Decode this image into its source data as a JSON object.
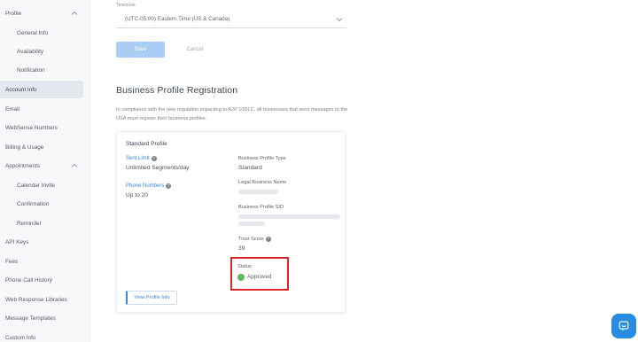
{
  "sidebar": {
    "items": [
      {
        "label": "Profile",
        "expanded": true
      },
      {
        "label": "General Info"
      },
      {
        "label": "Availability"
      },
      {
        "label": "Notification"
      },
      {
        "label": "Account Info",
        "active": true
      },
      {
        "label": "Email"
      },
      {
        "label": "WebSense Numbers"
      },
      {
        "label": "Billing & Usage"
      },
      {
        "label": "Appointments",
        "expanded": true
      },
      {
        "label": "Calendar Invite"
      },
      {
        "label": "Confirmation"
      },
      {
        "label": "Reminder"
      },
      {
        "label": "API Keys"
      },
      {
        "label": "Fees"
      },
      {
        "label": "Phone Call History"
      },
      {
        "label": "Web Response Libraries"
      },
      {
        "label": "Message Templates"
      },
      {
        "label": "Custom Info"
      }
    ]
  },
  "timezone": {
    "label": "Timezone",
    "value": "(UTC-05:00) Eastern Time (US & Canada)"
  },
  "buttons": {
    "save": "Save",
    "cancel": "Cancel"
  },
  "registration": {
    "title": "Business Profile Registration",
    "description": "In compliance with the new regulation impacting to A2P 10DLC, all businesses that send messages to the USA must register their business profiles."
  },
  "card": {
    "title": "Standard Profile",
    "sent_limit_label": "Sent Limit",
    "sent_limit_value": "Unlimited Segments/day",
    "phone_numbers_label": "Phone Numbers",
    "phone_numbers_value": "Up to 20",
    "profile_type_label": "Business Profile Type",
    "profile_type_value": "Standard",
    "legal_name_label": "Legal Business Name",
    "profile_sid_label": "Business Profile SID",
    "trust_score_label": "Trust Score",
    "trust_score_value": "39",
    "status_label": "Status",
    "status_value": "Approved",
    "view_button": "View Profile Info"
  },
  "colors": {
    "accent": "#3b87d8",
    "highlight": "#d9262b",
    "success": "#5cb85c",
    "chat": "#2a8be3"
  }
}
